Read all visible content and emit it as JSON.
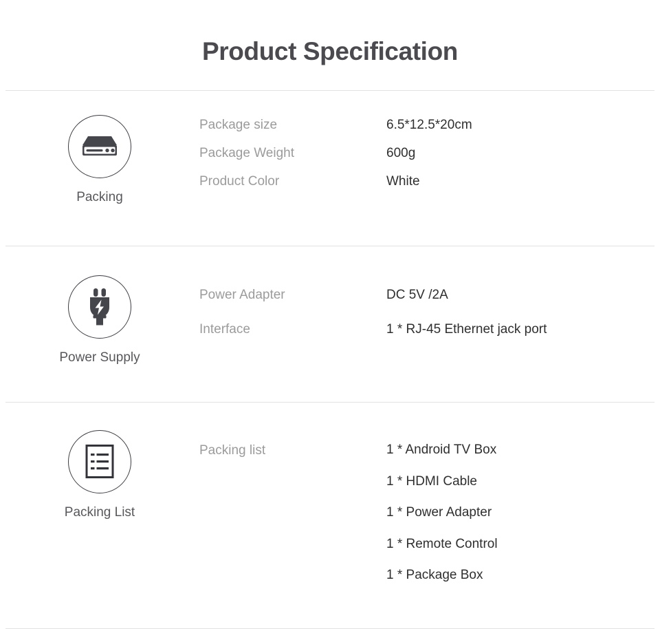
{
  "page": {
    "title": "Product Specification",
    "background": "#ffffff",
    "title_color": "#4a4a4f",
    "label_color": "#9b9b9b",
    "value_color": "#2f2f2f",
    "divider_color": "#e2e2e2",
    "icon_color": "#3b3b42"
  },
  "sections": [
    {
      "id": "packing",
      "icon": "set-top-box-icon",
      "caption": "Packing",
      "rows": [
        {
          "label": "Package size",
          "value": "6.5*12.5*20cm"
        },
        {
          "label": "Package Weight",
          "value": "600g"
        },
        {
          "label": "Product Color",
          "value": "White"
        }
      ]
    },
    {
      "id": "power-supply",
      "icon": "power-plug-icon",
      "caption": "Power Supply",
      "rows": [
        {
          "label": "Power Adapter",
          "value": "DC 5V /2A"
        },
        {
          "label": "Interface",
          "value": "1 * RJ-45 Ethernet jack port"
        }
      ]
    },
    {
      "id": "packing-list",
      "icon": "list-document-icon",
      "caption": "Packing List",
      "list_label": "Packing list",
      "items": [
        "1 * Android TV Box",
        "1 * HDMI Cable",
        "1 * Power Adapter",
        "1 * Remote Control",
        "1 * Package Box"
      ]
    }
  ]
}
